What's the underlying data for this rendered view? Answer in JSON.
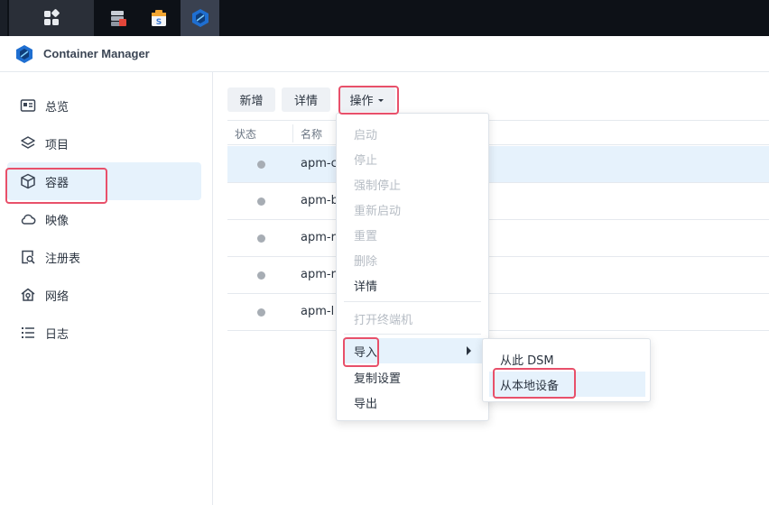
{
  "app": {
    "title": "Container Manager"
  },
  "sidebar": {
    "items": [
      {
        "label": "总览",
        "icon": "overview-icon"
      },
      {
        "label": "项目",
        "icon": "layers-icon"
      },
      {
        "label": "容器",
        "icon": "cube-icon",
        "active": true
      },
      {
        "label": "映像",
        "icon": "cloud-icon"
      },
      {
        "label": "注册表",
        "icon": "registry-search-icon"
      },
      {
        "label": "网络",
        "icon": "network-icon"
      },
      {
        "label": "日志",
        "icon": "list-icon"
      }
    ]
  },
  "toolbar": {
    "new_label": "新增",
    "details_label": "详情",
    "action_label": "操作"
  },
  "table": {
    "headers": {
      "state": "状态",
      "name": "名称"
    },
    "rows": [
      {
        "name": "apm-c"
      },
      {
        "name": "apm-b"
      },
      {
        "name": "apm-r"
      },
      {
        "name": "apm-r"
      },
      {
        "name": "apm-l"
      }
    ]
  },
  "action_menu": {
    "items": [
      {
        "label": "启动",
        "enabled": false
      },
      {
        "label": "停止",
        "enabled": false
      },
      {
        "label": "强制停止",
        "enabled": false
      },
      {
        "label": "重新启动",
        "enabled": false
      },
      {
        "label": "重置",
        "enabled": false
      },
      {
        "label": "删除",
        "enabled": false
      },
      {
        "label": "详情",
        "enabled": true
      },
      {
        "label": "打开终端机",
        "enabled": false
      },
      {
        "label": "导入",
        "enabled": true,
        "submenu": true
      },
      {
        "label": "复制设置",
        "enabled": true
      },
      {
        "label": "导出",
        "enabled": true
      }
    ]
  },
  "import_submenu": {
    "items": [
      {
        "label": "从此 DSM"
      },
      {
        "label": "从本地设备"
      }
    ]
  },
  "colors": {
    "highlight": "#e8506a",
    "selection": "#e6f2fc",
    "taskbar": "#0d1117"
  }
}
